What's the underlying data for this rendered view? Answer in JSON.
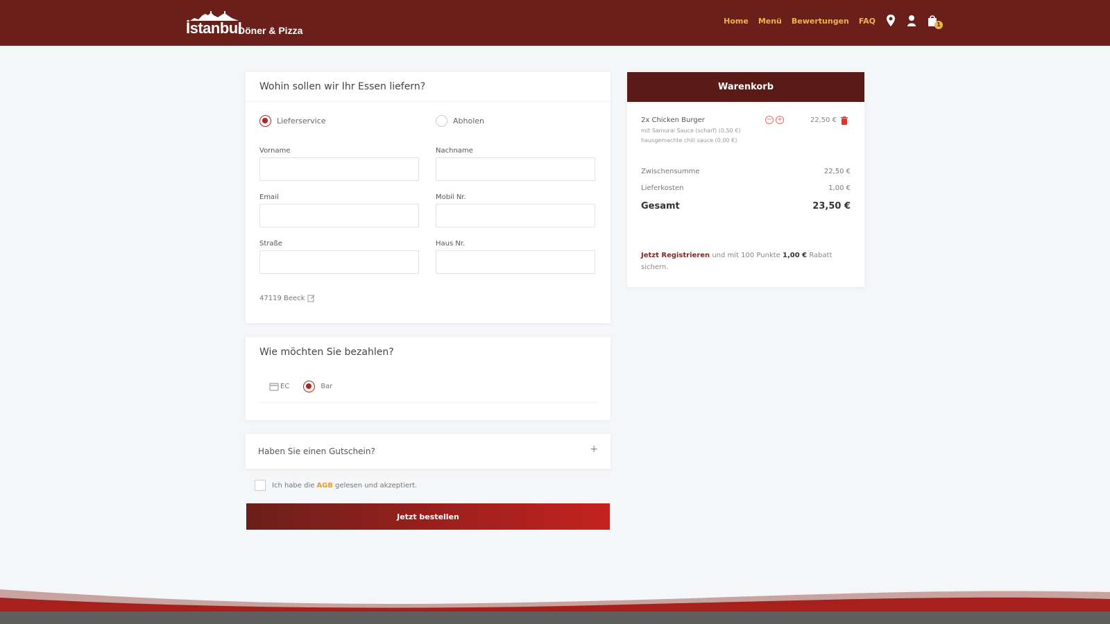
{
  "brand": {
    "main": "İstanbul",
    "sub": "Döner & Pizza"
  },
  "nav": {
    "links": [
      "Home",
      "Menü",
      "Bewertungen",
      "FAQ"
    ],
    "icons": [
      "location-pin-icon",
      "user-icon",
      "shopping-bag-icon"
    ],
    "cart_count": "1"
  },
  "delivery": {
    "title": "Wohin sollen wir Ihr Essen liefern?",
    "options": [
      "Lieferservice",
      "Abholen"
    ],
    "selected": "Lieferservice",
    "fields": {
      "vorname": {
        "label": "Vorname",
        "value": ""
      },
      "nachname": {
        "label": "Nachname",
        "value": ""
      },
      "email": {
        "label": "Email",
        "value": ""
      },
      "mobil": {
        "label": "Mobil Nr.",
        "value": ""
      },
      "strasse": {
        "label": "Straße",
        "value": ""
      },
      "hausnr": {
        "label": "Haus Nr.",
        "value": ""
      }
    },
    "plz": "47119 Beeck"
  },
  "payment": {
    "title": "Wie möchten Sie bezahlen?",
    "options": [
      "EC",
      "Bar"
    ],
    "selected": "Bar"
  },
  "voucher": {
    "label": "Haben Sie einen Gutschein?",
    "toggle": "+"
  },
  "agb": {
    "before": "Ich habe die",
    "link": "AGB",
    "after": "gelesen und akzeptiert."
  },
  "order_button": "Jetzt bestellen",
  "cart": {
    "title": "Warenkorb",
    "item": {
      "name": "2x Chicken Burger",
      "options": [
        "mit Samurai Sauce (scharf) (0,50 €)",
        "hausgemachte chili sauce (0,00 €)"
      ],
      "price": "22,50 €"
    },
    "subtotal_label": "Zwischensumme",
    "subtotal": "22,50 €",
    "delivery_label": "Lieferkosten",
    "delivery": "1,00 €",
    "total_label": "Gesamt",
    "total": "23,50 €",
    "promo": {
      "link": "Jetzt Registrieren",
      "text": "und mit 100 Punkte",
      "amount": "1,00 €",
      "after": "Rabatt sichern."
    }
  },
  "colors": {
    "header": "#6b1f1a",
    "accent": "#e8b64a",
    "cart_header": "#5a1a16",
    "button_end": "#c4221f"
  }
}
